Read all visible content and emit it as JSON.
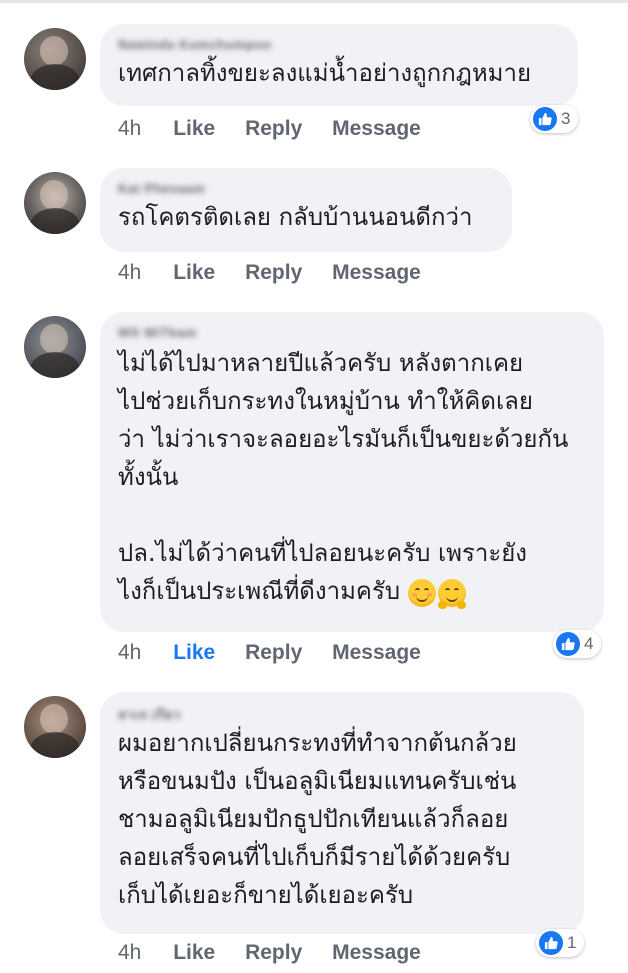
{
  "comments": [
    {
      "author": "Nawinda Kumchumpoo",
      "text": "เทศกาลทิ้งขยะลงแม่น้ำอย่างถูกกฎหมาย",
      "time": "4h",
      "like_label": "Like",
      "reply_label": "Reply",
      "message_label": "Message",
      "reaction_count": "3",
      "liked": false
    },
    {
      "author": "Kat Phesaam",
      "text": "รถโคตรติดเลย กลับบ้านนอนดีกว่า",
      "time": "4h",
      "like_label": "Like",
      "reply_label": "Reply",
      "message_label": "Message",
      "reaction_count": "",
      "liked": false
    },
    {
      "author": "WS WiTkam",
      "text": "ไม่ได้ไปมาหลายปีแล้วครับ หลังตากเคย\nไปช่วยเก็บกระทงในหมู่บ้าน ทำให้คิดเลย\nว่า ไม่ว่าเราจะลอยอะไรมันก็เป็นขยะด้วยกัน\nทั้งนั้น\n\nปล.ไม่ได้ว่าคนที่ไปลอยนะครับ เพราะยัง\nไงก็เป็นประเพณีที่ดีงามครับ",
      "emojis": [
        "smiling-face-icon",
        "hugging-face-icon"
      ],
      "time": "4h",
      "like_label": "Like",
      "reply_label": "Reply",
      "message_label": "Message",
      "reaction_count": "4",
      "liked": true
    },
    {
      "author": "ลาเจ เกียว",
      "text": "ผมอยากเปลี่ยนกระทงที่ทำจากต้นกล้วย\nหรือขนมปัง เป็นอลูมิเนียมแทนครับเช่น\nชามอลูมิเนียมปักธูปปักเทียนแล้วก็ลอย\nลอยเสร็จคนที่ไปเก็บก็มีรายได้ด้วยครับ\nเก็บได้เยอะก็ขายได้เยอะครับ",
      "time": "4h",
      "like_label": "Like",
      "reply_label": "Reply",
      "message_label": "Message",
      "reaction_count": "1",
      "liked": false
    }
  ],
  "colors": {
    "bubble": "#f0f2f5",
    "like_blue": "#1877f2",
    "action_gray": "#606770"
  }
}
